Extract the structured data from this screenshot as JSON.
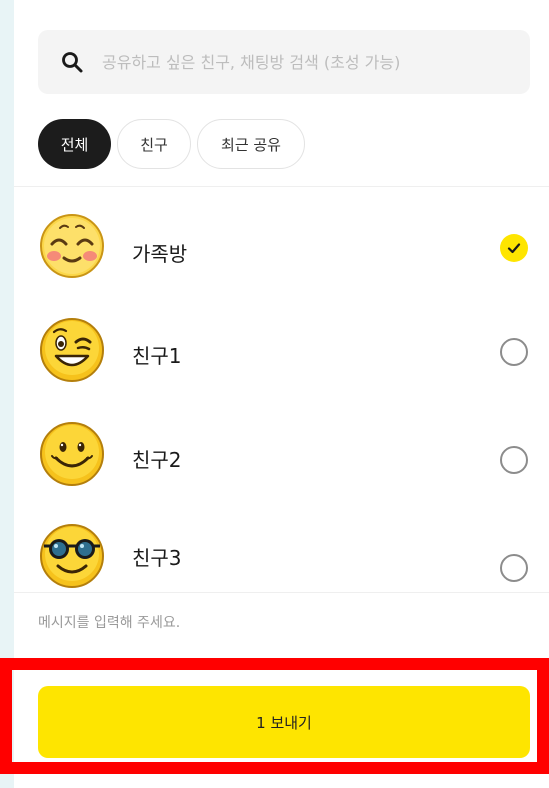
{
  "search": {
    "placeholder": "공유하고 싶은 친구, 채팅방 검색 (초성 가능)",
    "icon": "search-icon"
  },
  "tabs": [
    {
      "label": "전체",
      "active": true
    },
    {
      "label": "친구",
      "active": false
    },
    {
      "label": "최근 공유",
      "active": false
    }
  ],
  "list": {
    "items": [
      {
        "label": "가족방",
        "avatar": "blushing-smile-emoji",
        "selected": true
      },
      {
        "label": "친구1",
        "avatar": "winking-grin-emoji",
        "selected": false
      },
      {
        "label": "친구2",
        "avatar": "smiling-emoji",
        "selected": false
      },
      {
        "label": "친구3",
        "avatar": "sunglasses-emoji",
        "selected": false
      }
    ]
  },
  "message": {
    "placeholder": "메시지를 입력해 주세요."
  },
  "send": {
    "label": "1 보내기"
  },
  "colors": {
    "accent": "#fee500",
    "active_chip": "#1c1c1c",
    "highlight": "#ff0000"
  }
}
